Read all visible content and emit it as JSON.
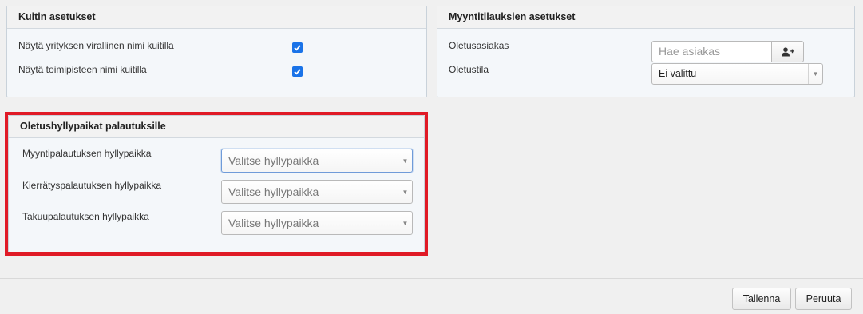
{
  "receipt_settings": {
    "title": "Kuitin asetukset",
    "rows": [
      {
        "label": "Näytä yrityksen virallinen nimi kuitilla",
        "checked": true
      },
      {
        "label": "Näytä toimipisteen nimi kuitilla",
        "checked": true
      }
    ]
  },
  "sales_order_settings": {
    "title": "Myyntitilauksien asetukset",
    "customer_label": "Oletusasiakas",
    "customer_placeholder": "Hae asiakas",
    "add_customer_icon": "user-plus-icon",
    "status_label": "Oletustila",
    "status_value": "Ei valittu"
  },
  "return_shelves": {
    "title": "Oletushyllypaikat palautuksille",
    "rows": [
      {
        "label": "Myyntipalautuksen hyllypaikka",
        "value": "Valitse hyllypaikka"
      },
      {
        "label": "Kierrätyspalautuksen hyllypaikka",
        "value": "Valitse hyllypaikka"
      },
      {
        "label": "Takuupalautuksen hyllypaikka",
        "value": "Valitse hyllypaikka"
      }
    ]
  },
  "footer": {
    "save_label": "Tallenna",
    "cancel_label": "Peruuta"
  },
  "colors": {
    "highlight": "#e01a26",
    "checkbox": "#1a73e8"
  }
}
